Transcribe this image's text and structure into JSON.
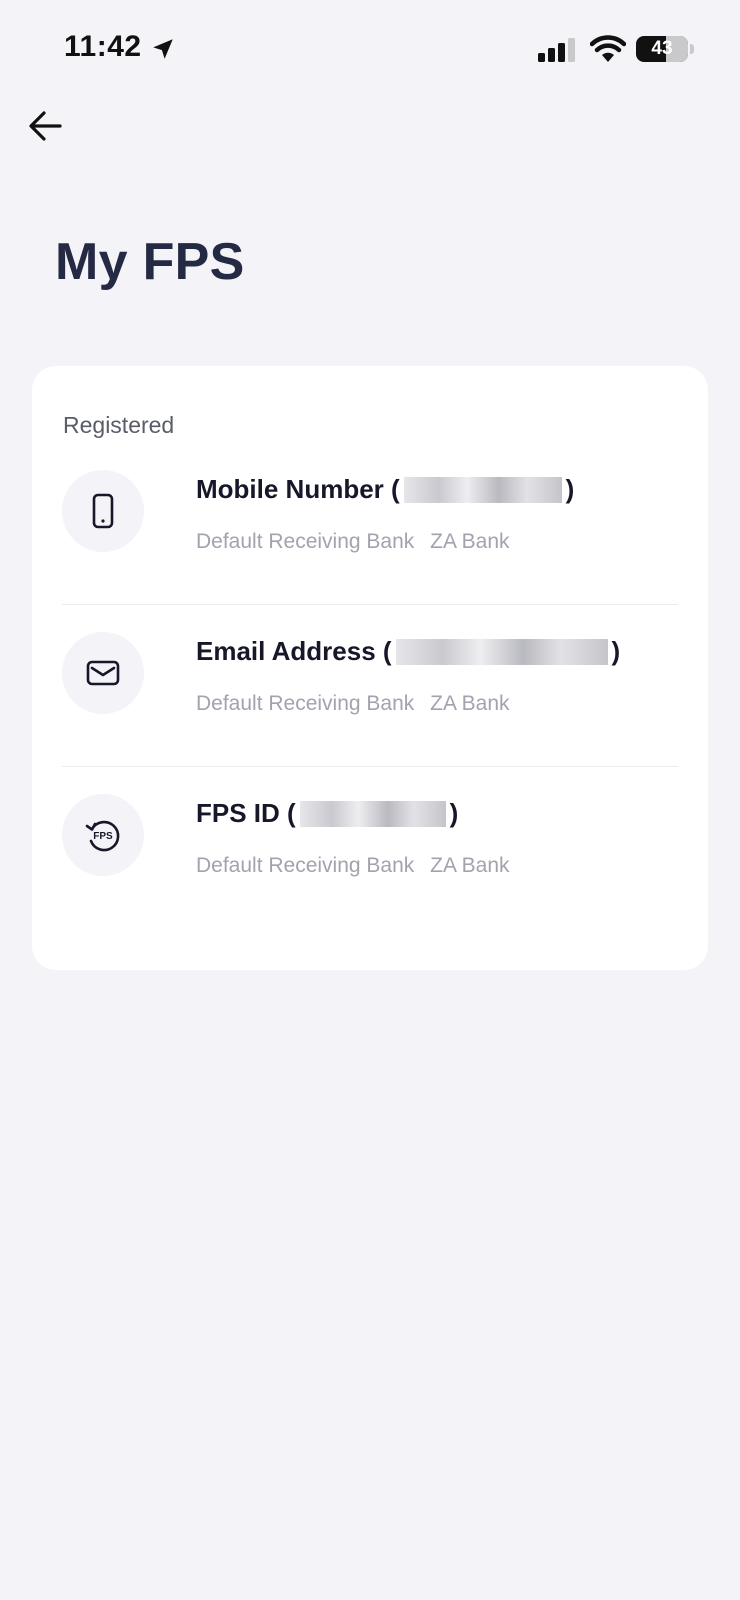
{
  "status_bar": {
    "time": "11:42",
    "battery": "43",
    "icons": [
      "location-arrow-icon",
      "signal-icon",
      "wifi-icon",
      "battery-icon"
    ]
  },
  "header": {
    "back_icon": "arrow-left-icon",
    "title": "My FPS"
  },
  "registered": {
    "section_label": "Registered",
    "items": [
      {
        "icon": "mobile-phone-icon",
        "label": "Mobile Number (",
        "close": ")",
        "sub_label": "Default Receiving Bank",
        "bank": "ZA Bank"
      },
      {
        "icon": "envelope-icon",
        "label": "Email Address (",
        "close": ")",
        "sub_label": "Default Receiving Bank",
        "bank": "ZA Bank"
      },
      {
        "icon": "fps-logo-icon",
        "icon_text": "FPS",
        "label": "FPS ID (",
        "close": ")",
        "sub_label": "Default Receiving Bank",
        "bank": "ZA Bank"
      }
    ]
  },
  "colors": {
    "background": "#f4f3f8",
    "card": "#ffffff",
    "title": "#252a44",
    "secondary_text": "#a1a3ae"
  }
}
